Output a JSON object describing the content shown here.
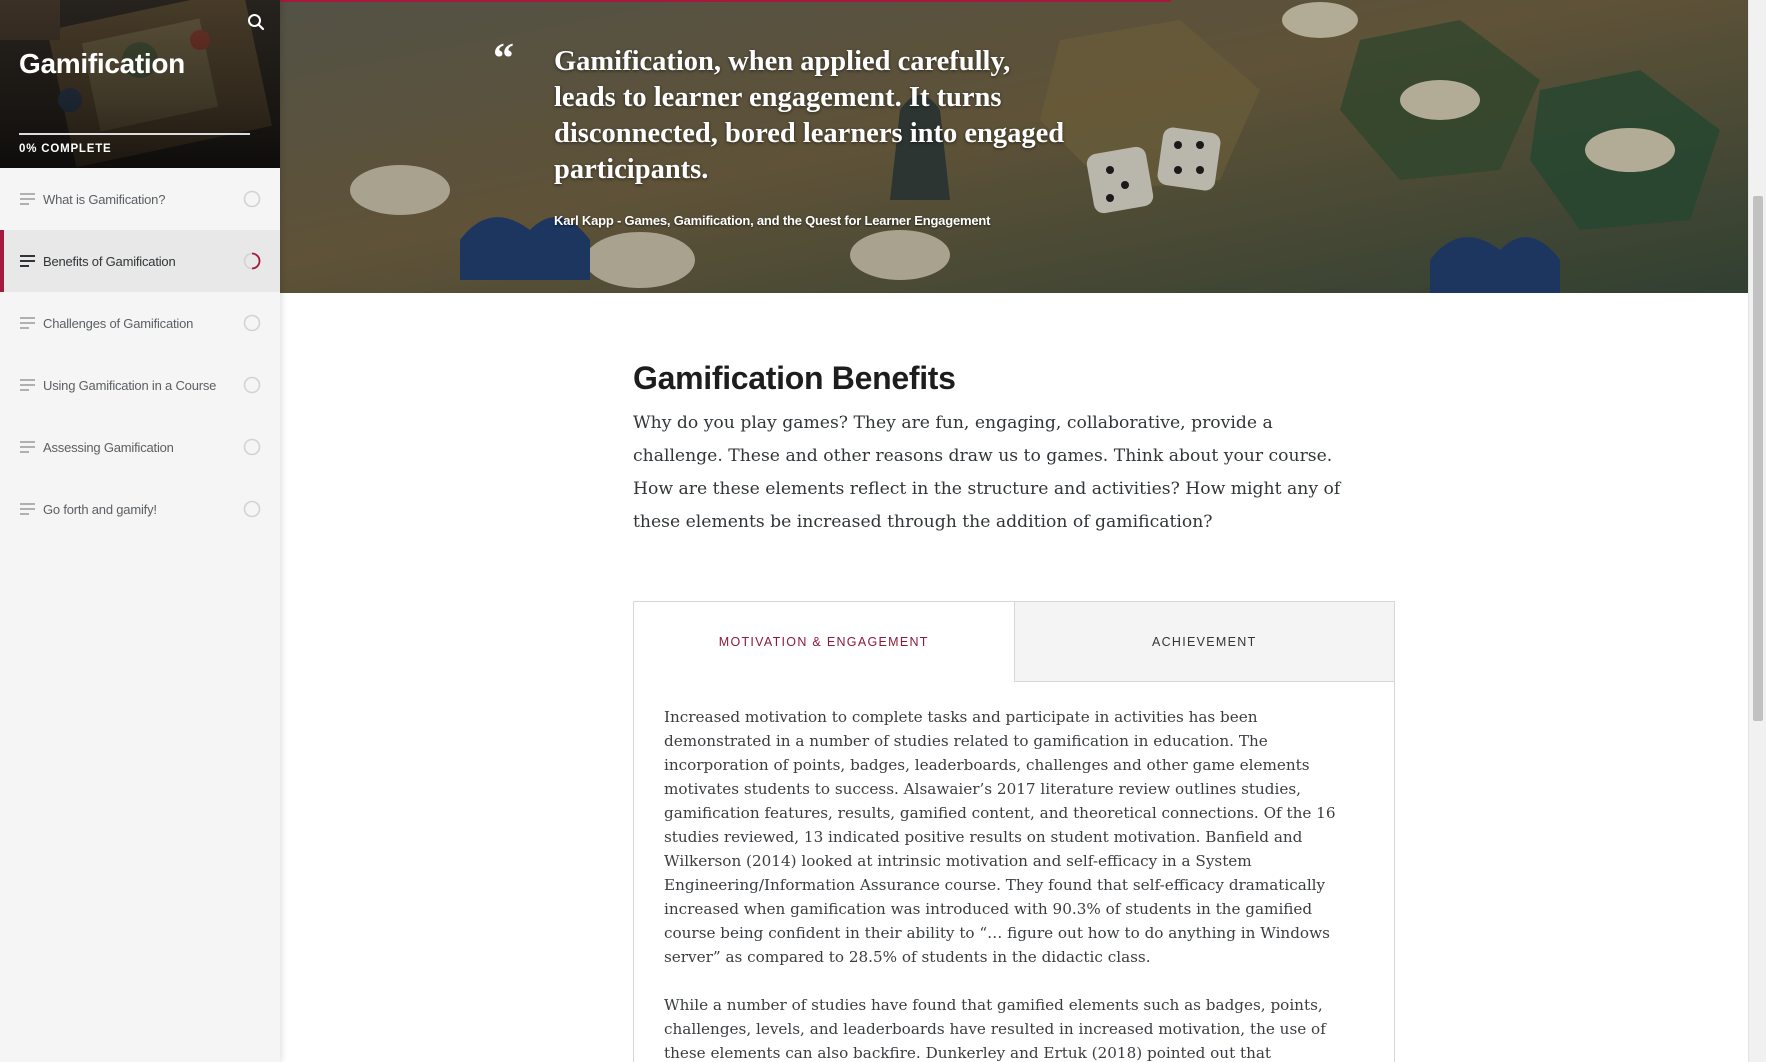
{
  "course": {
    "title": "Gamification",
    "progress_percent": 0,
    "progress_label": "0% COMPLETE"
  },
  "sidebar": {
    "search_icon": "search-icon",
    "items": [
      {
        "label": "What is Gamification?",
        "status": "not-started"
      },
      {
        "label": "Benefits of Gamification",
        "status": "in-progress",
        "active": true
      },
      {
        "label": "Challenges of Gamification",
        "status": "not-started"
      },
      {
        "label": "Using Gamification in a Course",
        "status": "not-started"
      },
      {
        "label": "Assessing Gamification",
        "status": "not-started"
      },
      {
        "label": "Go forth and gamify!",
        "status": "not-started"
      }
    ]
  },
  "hero": {
    "quote_mark": "“",
    "quote": "Gamification, when applied carefully, leads to learner engagement. It turns disconnected, bored learners into engaged participants.",
    "citation": "Karl Kapp - Games, Gamification, and the Quest for Learner Engagement"
  },
  "main": {
    "heading": "Gamification Benefits",
    "intro": "Why do you play games?  They are fun, engaging, collaborative, provide a challenge. These and other reasons draw us to games. Think about your course. How are these elements reflect in the structure and activities? How might any of these elements be increased through the addition of gamification?",
    "tabs": [
      {
        "label": "MOTIVATION & ENGAGEMENT",
        "active": true
      },
      {
        "label": "ACHIEVEMENT",
        "active": false
      }
    ],
    "tab_paragraphs": [
      "Increased motivation to complete tasks and participate in activities has been demonstrated in a number of studies related to gamification in education. The incorporation of points, badges, leaderboards, challenges and other game elements motivates students to success. Alsawaier’s 2017 literature review outlines studies, gamification features, results, gamified content, and theoretical connections. Of the 16 studies reviewed, 13 indicated positive results on student motivation. Banfield and Wilkerson (2014) looked at intrinsic motivation and self-efficacy in a System Engineering/Information Assurance course. They found that self-efficacy dramatically increased when gamification was introduced with 90.3% of students in the gamified course being confident in their ability to “… figure out how to do anything in Windows server” as compared to 28.5% of students in the didactic class.",
      "While a number of studies have found that gamified elements such as badges, points, challenges, levels, and leaderboards have resulted in increased motivation, the use of these elements can also backfire. Dunkerley and Ertuk (2018) pointed out that"
    ]
  },
  "colors": {
    "accent": "#a6193e",
    "active_tab_text": "#8b1a3a",
    "sidebar_bg": "#f5f5f5",
    "text": "#313537"
  }
}
